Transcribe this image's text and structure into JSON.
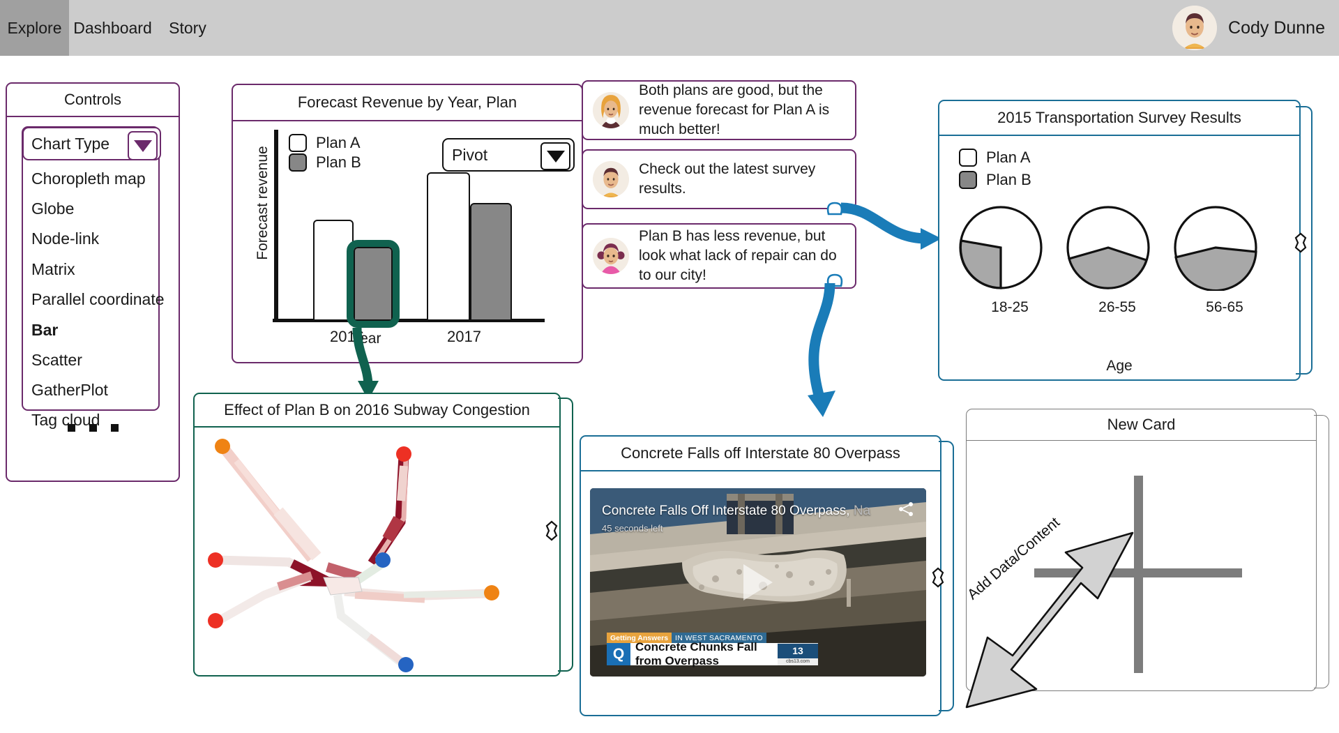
{
  "nav": {
    "tabs": [
      {
        "label": "Explore",
        "active": true
      },
      {
        "label": "Dashboard",
        "active": false
      },
      {
        "label": "Story",
        "active": false
      }
    ],
    "user": {
      "name": "Cody Dunne",
      "avatar": "male-avatar-orange-shirt"
    }
  },
  "controls": {
    "title": "Controls",
    "dropdown": {
      "label": "Chart Type",
      "caret_icon": "chevron-down-icon",
      "selected": "Bar",
      "options": [
        "Choropleth map",
        "Globe",
        "Node-link",
        "Matrix",
        "Parallel coordinate",
        "Bar",
        "Scatter",
        "GatherPlot",
        "Tag cloud"
      ]
    },
    "more_indicator": "..."
  },
  "bar_card": {
    "title": "Forecast Revenue by Year, Plan",
    "pivot": {
      "label": "Pivot",
      "caret_icon": "chevron-down-icon"
    },
    "legend": [
      {
        "label": "Plan A",
        "swatch": "white"
      },
      {
        "label": "Plan B",
        "swatch": "gray"
      }
    ],
    "selected_bar": "2016 Plan B",
    "selection_color": "#10624f"
  },
  "comments": [
    {
      "avatar": "female-avatar-blonde",
      "text": "Both plans are good, but the revenue forecast for Plan A is much better!"
    },
    {
      "avatar": "male-avatar-orange-shirt",
      "text": "Check out the latest survey results."
    },
    {
      "avatar": "girl-avatar-pigtails-pink",
      "text": "Plan B has less revenue, but look what lack of repair can do to our city!"
    }
  ],
  "survey_card": {
    "title": "2015 Transportation Survey Results",
    "legend": [
      {
        "label": "Plan A",
        "swatch": "white"
      },
      {
        "label": "Plan B",
        "swatch": "gray"
      }
    ],
    "axis_label": "Age"
  },
  "subway_card": {
    "title": "Effect of Plan B on 2016 Subway Congestion"
  },
  "video_card": {
    "title": "Concrete Falls off Interstate 80 Overpass",
    "overlay_title": "Concrete Falls Off Interstate 80 Overpass,",
    "overlay_title_dim": "Na",
    "time_left": "45 seconds left",
    "share_icon": "share-icon",
    "play_icon": "play-icon",
    "lower_third": {
      "kicker": "Getting Answers",
      "location": "IN WEST SACRAMENTO",
      "headline": "Concrete Chunks Fall from Overpass",
      "channel_logo": "13",
      "channel_url": "cbs13.com",
      "source_mark": "Q"
    }
  },
  "new_card": {
    "title": "New Card",
    "add_label": "Add Data/Content",
    "plus_icon": "plus-icon",
    "arrow_icon": "arrow-up-right-icon"
  },
  "theme": {
    "purple": "#6b2a6b",
    "blue": "#1a6e96",
    "green": "#10624f",
    "gray": "#7a7a7a",
    "nav_bg": "#cccccc",
    "nav_active_bg": "#a0a0a0",
    "arrow_connector": "#1a7cb8"
  },
  "chart_data": [
    {
      "type": "bar",
      "title": "Forecast Revenue by Year, Plan",
      "xlabel": "Year",
      "ylabel": "Forecast revenue",
      "categories": [
        "2016",
        "2017"
      ],
      "series": [
        {
          "name": "Plan A",
          "values": [
            52,
            90
          ]
        },
        {
          "name": "Plan B",
          "values": [
            37,
            69
          ]
        }
      ],
      "ylim": [
        0,
        100
      ],
      "grid": false,
      "legend_position": "top-left"
    },
    {
      "type": "pie",
      "title": "2015 Transportation Survey Results",
      "xlabel": "Age",
      "groups": [
        "18-25",
        "26-55",
        "56-65"
      ],
      "slices": [
        {
          "group": "18-25",
          "Plan A": 82,
          "Plan B": 18
        },
        {
          "group": "26-55",
          "Plan A": 60,
          "Plan B": 40
        },
        {
          "group": "56-65",
          "Plan A": 55,
          "Plan B": 45
        }
      ],
      "legend": [
        "Plan A",
        "Plan B"
      ],
      "legend_position": "top-left"
    }
  ]
}
